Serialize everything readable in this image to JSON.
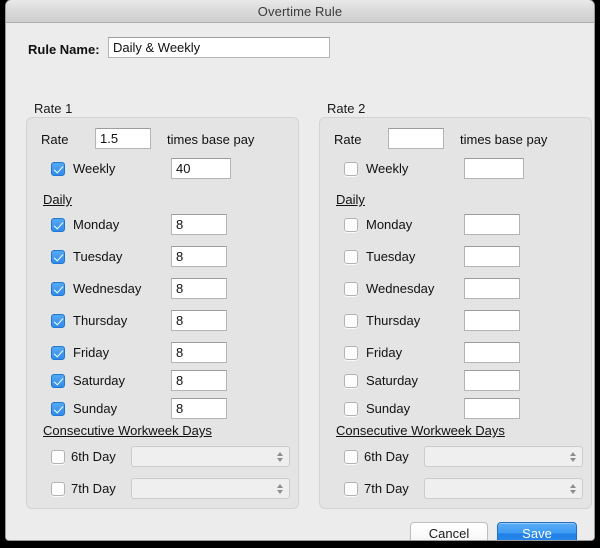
{
  "window": {
    "title": "Overtime Rule"
  },
  "rule_name": {
    "label": "Rule Name:",
    "value": "Daily & Weekly",
    "placeholder": ""
  },
  "sections": {
    "daily_heading": "Daily",
    "consecutive_heading": "Consecutive Workweek Days",
    "rate_word": "Rate",
    "times_base_pay": "times base pay",
    "weekly_label": "Weekly",
    "sixth_day_label": "6th Day",
    "seventh_day_label": "7th Day"
  },
  "rate1": {
    "title": "Rate 1",
    "rate_value": "1.5",
    "weekly_checked": true,
    "weekly_value": "40",
    "days": [
      {
        "label": "Monday",
        "checked": true,
        "value": "8"
      },
      {
        "label": "Tuesday",
        "checked": true,
        "value": "8"
      },
      {
        "label": "Wednesday",
        "checked": true,
        "value": "8"
      },
      {
        "label": "Thursday",
        "checked": true,
        "value": "8"
      },
      {
        "label": "Friday",
        "checked": true,
        "value": "8"
      },
      {
        "label": "Saturday",
        "checked": true,
        "value": "8"
      },
      {
        "label": "Sunday",
        "checked": true,
        "value": "8"
      }
    ],
    "sixth_day_checked": false,
    "sixth_day_value": "",
    "seventh_day_checked": false,
    "seventh_day_value": ""
  },
  "rate2": {
    "title": "Rate 2",
    "rate_value": "",
    "weekly_checked": false,
    "weekly_value": "",
    "days": [
      {
        "label": "Monday",
        "checked": false,
        "value": ""
      },
      {
        "label": "Tuesday",
        "checked": false,
        "value": ""
      },
      {
        "label": "Wednesday",
        "checked": false,
        "value": ""
      },
      {
        "label": "Thursday",
        "checked": false,
        "value": ""
      },
      {
        "label": "Friday",
        "checked": false,
        "value": ""
      },
      {
        "label": "Saturday",
        "checked": false,
        "value": ""
      },
      {
        "label": "Sunday",
        "checked": false,
        "value": ""
      }
    ],
    "sixth_day_checked": false,
    "sixth_day_value": "",
    "seventh_day_checked": false,
    "seventh_day_value": ""
  },
  "buttons": {
    "cancel": "Cancel",
    "save": "Save"
  },
  "colors": {
    "accent_blue": "#3d9bf2",
    "checkbox_blue": "#2f8ceb",
    "window_bg": "#ececec",
    "panel_bg": "#e4e4e4"
  }
}
